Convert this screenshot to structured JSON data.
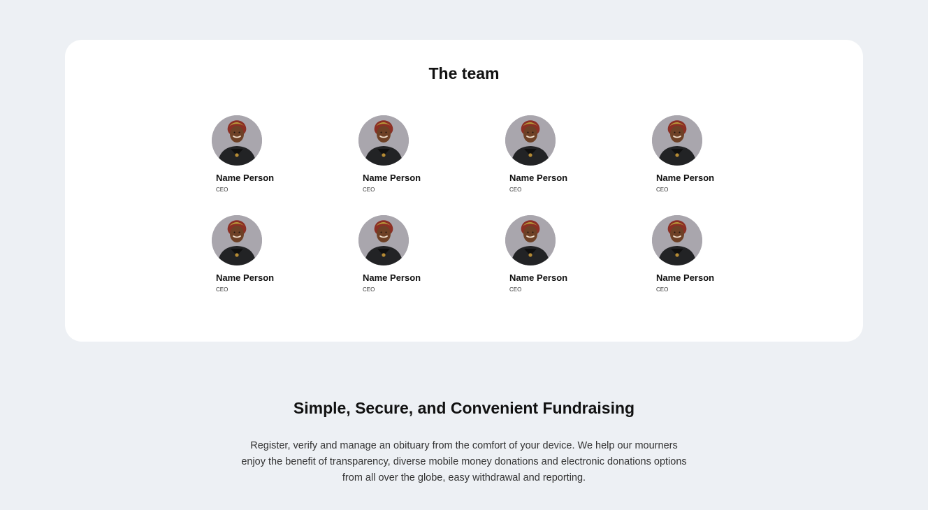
{
  "team": {
    "title": "The team",
    "members": [
      {
        "name": "Name Person",
        "role": "CEO"
      },
      {
        "name": "Name Person",
        "role": "CEO"
      },
      {
        "name": "Name Person",
        "role": "CEO"
      },
      {
        "name": "Name Person",
        "role": "CEO"
      },
      {
        "name": "Name Person",
        "role": "CEO"
      },
      {
        "name": "Name Person",
        "role": "CEO"
      },
      {
        "name": "Name Person",
        "role": "CEO"
      },
      {
        "name": "Name Person",
        "role": "CEO"
      }
    ]
  },
  "fundraising": {
    "title": "Simple, Secure, and Convenient Fundraising",
    "description": "Register, verify and manage an obituary from the comfort of your device. We help our mourners enjoy the benefit of transparency, diverse mobile money donations and electronic donations options from all over the globe, easy withdrawal and reporting."
  },
  "colors": {
    "page_background": "#edf0f4",
    "card_background": "#ffffff",
    "avatar_background": "#a9a6ad",
    "heading": "#111111",
    "body_text": "#333333"
  }
}
